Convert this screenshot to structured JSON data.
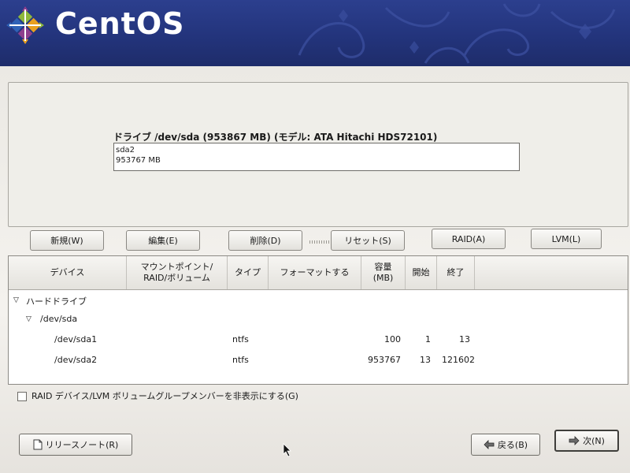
{
  "header": {
    "brand": "CentOS",
    "colors": {
      "banner": "#23347c",
      "logo_purple": "#8e3f8e",
      "logo_green": "#8fb83c",
      "logo_orange": "#e8a020",
      "logo_blue": "#2f62b6"
    }
  },
  "drive": {
    "label": "ドライブ /dev/sda (953867 MB) (モデル: ATA Hitachi HDS72101)",
    "partition_name": "sda2",
    "partition_size": "953767 MB"
  },
  "toolbar": {
    "new": "新規(W)",
    "edit": "編集(E)",
    "delete": "削除(D)",
    "reset": "リセット(S)",
    "raid": "RAID(A)",
    "lvm": "LVM(L)"
  },
  "table": {
    "headers": {
      "device": "デバイス",
      "mount_line1": "マウントポイント/",
      "mount_line2": "RAID/ボリューム",
      "type": "タイプ",
      "format": "フォーマットする",
      "size_line1": "容量",
      "size_line2": "(MB)",
      "start": "開始",
      "end": "終了"
    },
    "tree": {
      "hard_drives": "ハードドライブ",
      "disk": "/dev/sda"
    },
    "rows": [
      {
        "device": "/dev/sda1",
        "type": "ntfs",
        "size": "100",
        "start": "1",
        "end": "13"
      },
      {
        "device": "/dev/sda2",
        "type": "ntfs",
        "size": "953767",
        "start": "13",
        "end": "121602"
      }
    ]
  },
  "options": {
    "hide_raid_lvm": "RAID デバイス/LVM ボリュームグループメンバーを非表示にする(G)"
  },
  "nav": {
    "release_notes": "リリースノート(R)",
    "back": "戻る(B)",
    "next": "次(N)"
  }
}
